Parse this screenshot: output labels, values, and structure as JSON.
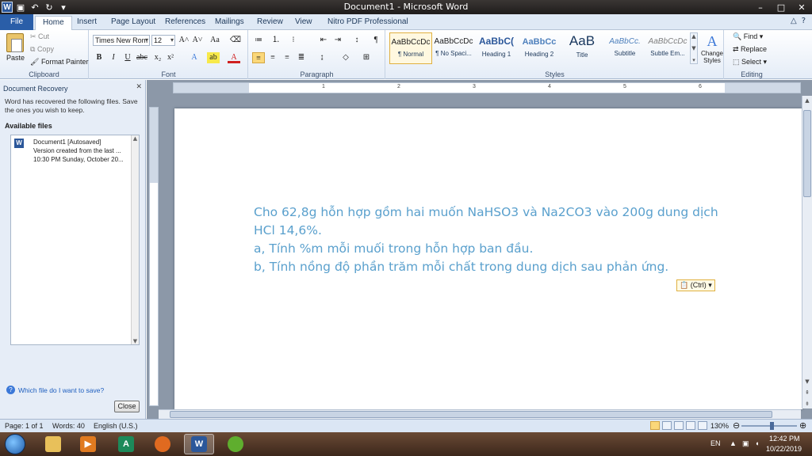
{
  "window": {
    "title": "Document1 - Microsoft Word",
    "controls": [
      "–",
      "□",
      "✕"
    ]
  },
  "qat": {
    "word_logo": "W",
    "save_icon": "save-icon",
    "undo_icon": "undo-icon",
    "redo_icon": "redo-icon"
  },
  "tabs": [
    {
      "label": "File"
    },
    {
      "label": "Home"
    },
    {
      "label": "Insert"
    },
    {
      "label": "Page Layout"
    },
    {
      "label": "References"
    },
    {
      "label": "Mailings"
    },
    {
      "label": "Review"
    },
    {
      "label": "View"
    },
    {
      "label": "Nitro PDF Professional"
    }
  ],
  "ribbon": {
    "clipboard": {
      "label": "Clipboard",
      "paste": "Paste",
      "cut": "Cut",
      "copy": "Copy",
      "format_painter": "Format Painter"
    },
    "font": {
      "label": "Font",
      "font_name": "Times New Rom",
      "font_size": "12",
      "bold": "B",
      "italic": "I",
      "underline": "U"
    },
    "paragraph": {
      "label": "Paragraph"
    },
    "styles": {
      "label": "Styles",
      "items": [
        {
          "sample": "AaBbCcDc",
          "name": "¶ Normal"
        },
        {
          "sample": "AaBbCcDc",
          "name": "¶ No Spaci..."
        },
        {
          "sample": "AaBbC(",
          "name": "Heading 1"
        },
        {
          "sample": "AaBbCc",
          "name": "Heading 2"
        },
        {
          "sample": "AaB",
          "name": "Title"
        },
        {
          "sample": "AaBbCc.",
          "name": "Subtitle"
        },
        {
          "sample": "AaBbCcDc",
          "name": "Subtle Em..."
        }
      ],
      "change_styles": "Change Styles"
    },
    "editing": {
      "label": "Editing",
      "find": "Find",
      "replace": "Replace",
      "select": "Select"
    }
  },
  "recovery": {
    "title": "Document Recovery",
    "message": "Word has recovered the following files.  Save the ones you wish to keep.",
    "section": "Available files",
    "files": [
      {
        "name": "Document1  [Autosaved]",
        "line2": "Version created from the last ...",
        "line3": "10:30 PM Sunday, October 20..."
      }
    ],
    "help_link": "Which file do I want to save?",
    "close": "Close"
  },
  "ruler": {
    "numbers": [
      "1",
      "2",
      "3",
      "4",
      "5",
      "6"
    ]
  },
  "document": {
    "lines": [
      "Cho 62,8g hỗn hợp gồm hai muốn NaHSO3 và Na2CO3 vào 200g dung dịch",
      "HCl 14,6%.",
      "a, Tính %m mỗi muối trong hỗn hợp ban đầu.",
      "b, Tính nồng độ phần trăm mỗi chất trong dung dịch sau phản ứng."
    ],
    "text_color": "#5aa0cd",
    "paste_options": "(Ctrl)"
  },
  "statusbar": {
    "page": "Page: 1 of 1",
    "words": "Words: 40",
    "language": "English (U.S.)",
    "zoom": "130%"
  },
  "taskbar": {
    "lang": "EN",
    "time": "12:42 PM",
    "date": "10/22/2019"
  }
}
